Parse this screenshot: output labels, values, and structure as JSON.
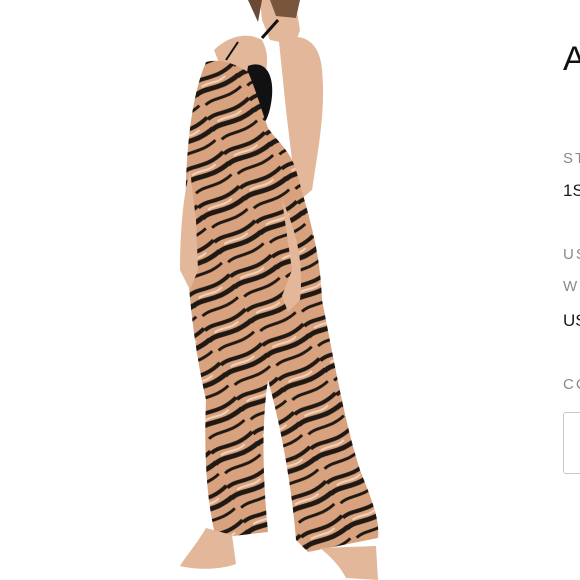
{
  "product": {
    "title": "A",
    "image_alt_icon": "product-photo"
  },
  "details": {
    "style_label": "ST",
    "style_value": "1S",
    "us_label": "US",
    "w_label": "W",
    "us_value": "US",
    "color_label": "CC"
  },
  "colors": {
    "background": "#ffffff",
    "tiger_light": "#d9a27e",
    "tiger_dark": "#1f1813",
    "skin": "#e3b79a",
    "bikini": "#111111"
  }
}
